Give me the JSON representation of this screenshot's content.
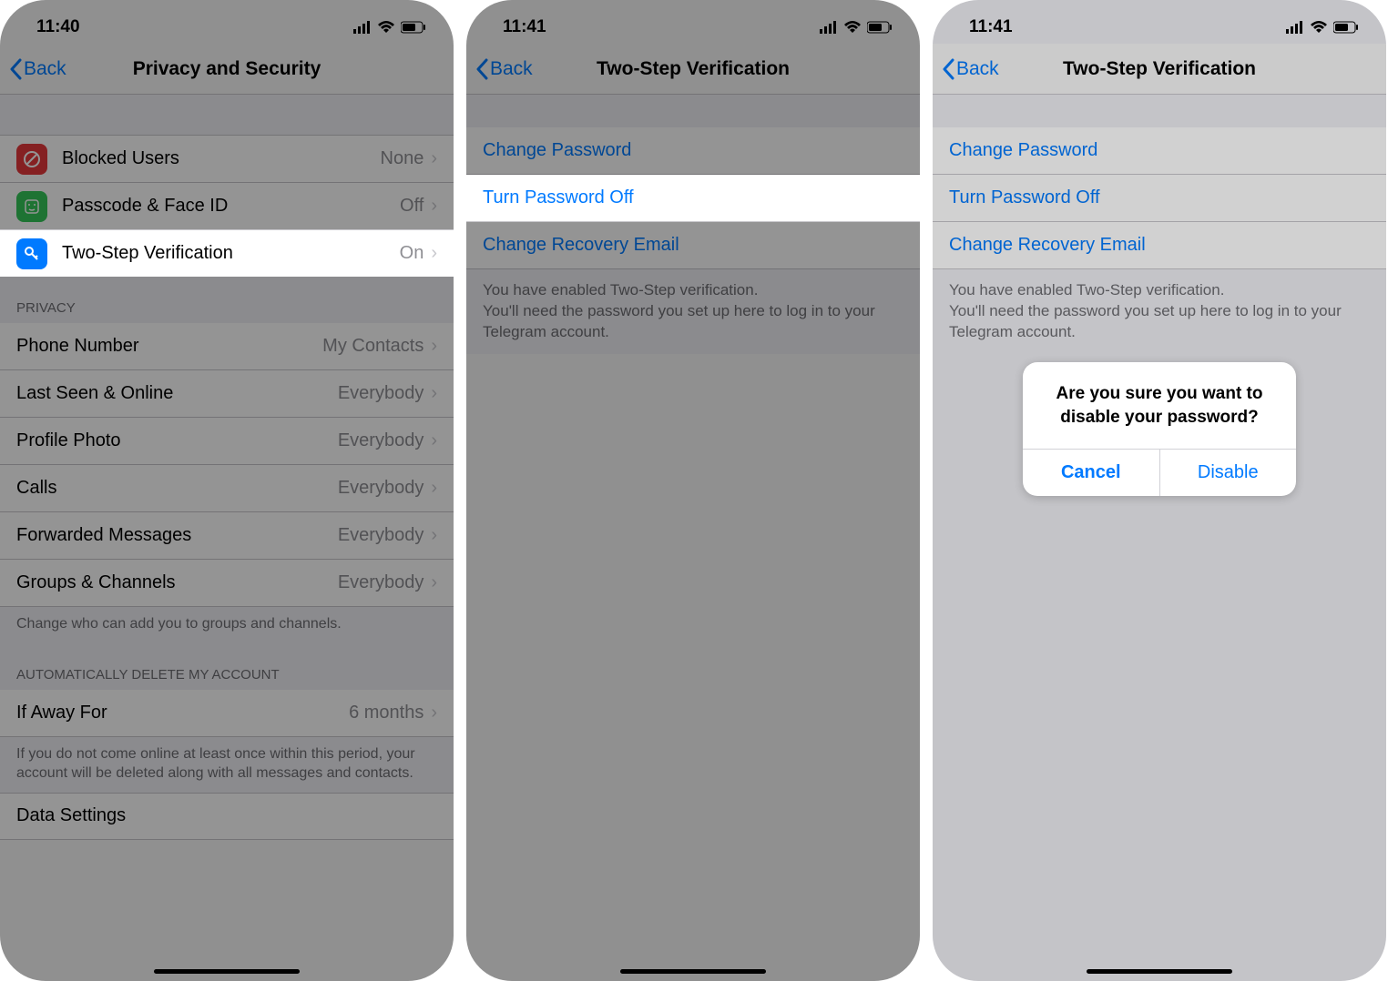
{
  "colors": {
    "accent": "#007aff",
    "red_icon": "#e5383b",
    "green_icon": "#34c759",
    "blue_icon": "#007aff"
  },
  "screen1": {
    "time": "11:40",
    "back": "Back",
    "title": "Privacy and Security",
    "security": [
      {
        "label": "Blocked Users",
        "value": "None"
      },
      {
        "label": "Passcode & Face ID",
        "value": "Off"
      },
      {
        "label": "Two-Step Verification",
        "value": "On"
      }
    ],
    "privacy_header": "Privacy",
    "privacy": [
      {
        "label": "Phone Number",
        "value": "My Contacts"
      },
      {
        "label": "Last Seen & Online",
        "value": "Everybody"
      },
      {
        "label": "Profile Photo",
        "value": "Everybody"
      },
      {
        "label": "Calls",
        "value": "Everybody"
      },
      {
        "label": "Forwarded Messages",
        "value": "Everybody"
      },
      {
        "label": "Groups & Channels",
        "value": "Everybody"
      }
    ],
    "privacy_footer": "Change who can add you to groups and channels.",
    "delete_header": "Automatically delete my account",
    "delete_row": {
      "label": "If Away For",
      "value": "6 months"
    },
    "delete_footer": "If you do not come online at least once within this period, your account will be deleted along with all messages and contacts.",
    "data_settings": "Data Settings"
  },
  "screen2": {
    "time": "11:41",
    "back": "Back",
    "title": "Two-Step Verification",
    "rows": [
      "Change Password",
      "Turn Password Off",
      "Change Recovery Email"
    ],
    "info": "You have enabled Two-Step verification.\nYou'll need the password you set up here to log in to your Telegram account."
  },
  "screen3": {
    "time": "11:41",
    "back": "Back",
    "title": "Two-Step Verification",
    "rows": [
      "Change Password",
      "Turn Password Off",
      "Change Recovery Email"
    ],
    "info": "You have enabled Two-Step verification.\nYou'll need the password you set up here to log in to your Telegram account.",
    "alert": {
      "title": "Are you sure you want to disable your password?",
      "cancel": "Cancel",
      "disable": "Disable"
    }
  }
}
